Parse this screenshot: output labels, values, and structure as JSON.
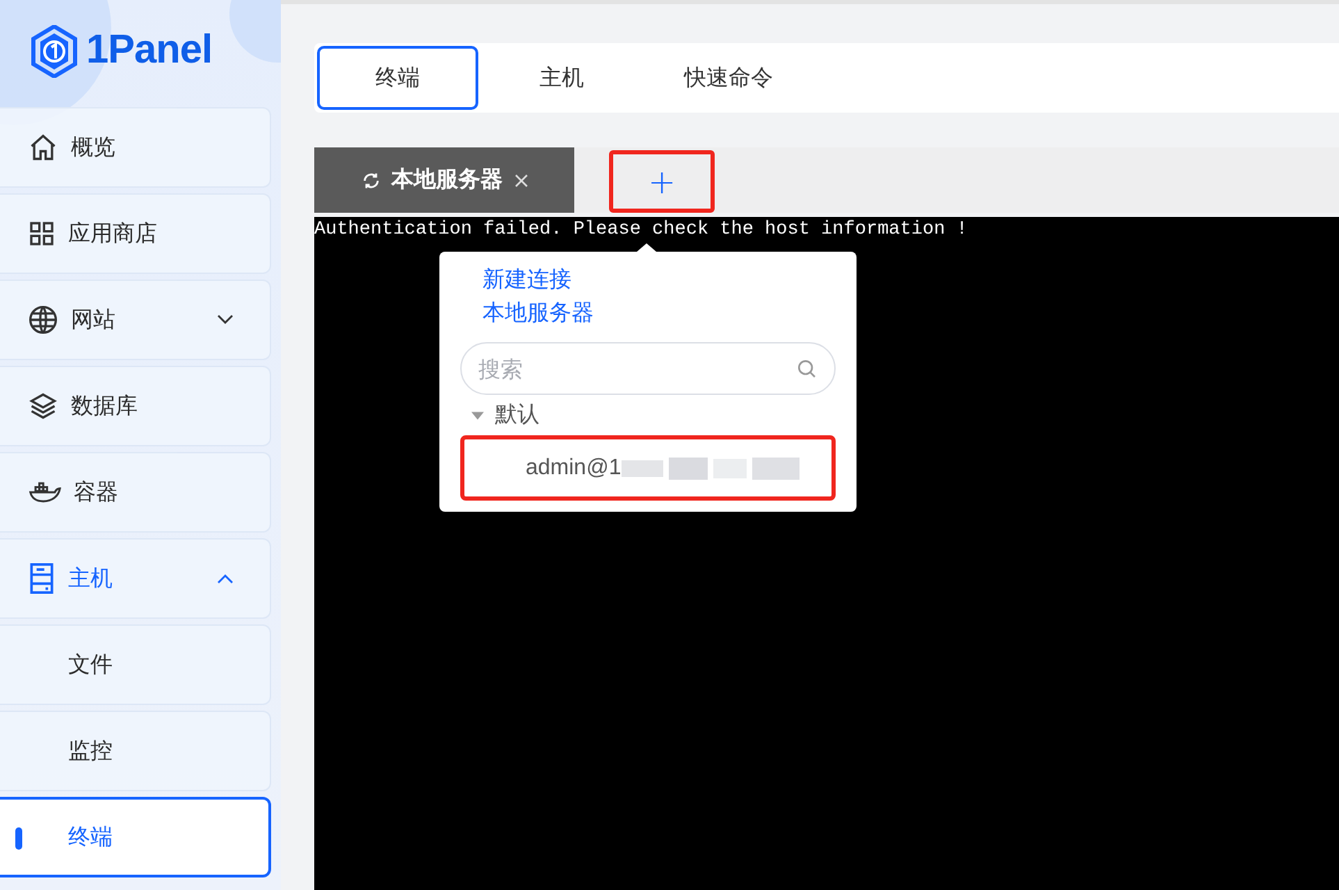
{
  "logo": {
    "text": "1Panel"
  },
  "sidebar": {
    "items": [
      {
        "label": "概览",
        "selected": false
      },
      {
        "label": "应用商店",
        "selected": false
      },
      {
        "label": "网站",
        "selected": false,
        "expanded": false
      },
      {
        "label": "数据库",
        "selected": false
      },
      {
        "label": "容器",
        "selected": false
      },
      {
        "label": "主机",
        "selected": true,
        "expanded": true,
        "children": [
          {
            "label": "文件",
            "selected": false
          },
          {
            "label": "监控",
            "selected": false
          },
          {
            "label": "终端",
            "selected": true
          }
        ]
      }
    ]
  },
  "tabs": [
    {
      "label": "终端",
      "selected": true
    },
    {
      "label": "主机",
      "selected": false
    },
    {
      "label": "快速命令",
      "selected": false
    }
  ],
  "terminal_tabs": [
    {
      "label": "本地服务器",
      "selected": true
    }
  ],
  "add_tab": {
    "label": "+",
    "highlighted": true
  },
  "terminal": {
    "lines": [
      "Authentication failed. Please check the host information !"
    ]
  },
  "popup": {
    "actions": [
      "新建连接",
      "本地服务器"
    ],
    "search": {
      "placeholder": "搜索"
    },
    "groups": [
      {
        "label": "默认",
        "expanded": true,
        "children": [
          {
            "label": "admin@1",
            "redacted": true,
            "highlighted": true
          }
        ]
      }
    ]
  }
}
